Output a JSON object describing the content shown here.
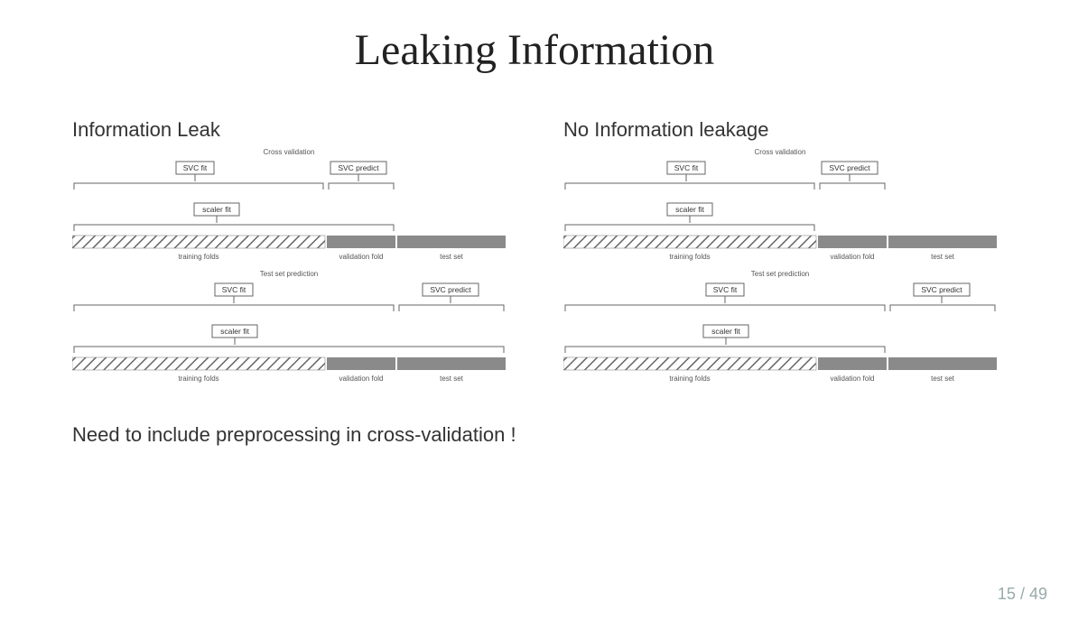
{
  "title": "Leaking Information",
  "left_heading": "Information Leak",
  "right_heading": "No Information leakage",
  "conclusion": "Need to include preprocessing in cross-validation !",
  "page_current": "15",
  "page_total": "49",
  "labels": {
    "cross_validation": "Cross validation",
    "test_set_prediction": "Test set prediction",
    "svc_fit": "SVC fit",
    "svc_predict": "SVC predict",
    "scaler_fit": "scaler fit",
    "training_folds": "training folds",
    "validation_fold": "validation fold",
    "test_set": "test set"
  },
  "chart_data": {
    "type": "diagram",
    "note": "Two side-by-side schematic pipelines comparing information leak vs no leakage. Each side has two subpanels (Cross validation, Test set prediction). Data bar is composed of: training folds (hatched), validation fold (grey), test set (grey). In the 'Information Leak' panels, scaler_fit spans training+validation (top) or all three segments (bottom). In the 'No Information leakage' panels, scaler_fit spans only training folds. SVC fit is applied over training folds; SVC predict is applied to validation fold (top) or test set (bottom).",
    "segments": {
      "training_folds": 0.58,
      "validation_fold": 0.16,
      "test_set": 0.26
    },
    "panels": [
      {
        "side": "left",
        "sub": "cross_validation",
        "scaler_fit_span": [
          "training_folds",
          "validation_fold"
        ],
        "svc_fit_span": [
          "training_folds"
        ],
        "svc_predict_target": "validation_fold"
      },
      {
        "side": "left",
        "sub": "test_set_prediction",
        "scaler_fit_span": [
          "training_folds",
          "validation_fold",
          "test_set"
        ],
        "svc_fit_span": [
          "training_folds",
          "validation_fold"
        ],
        "svc_predict_target": "test_set"
      },
      {
        "side": "right",
        "sub": "cross_validation",
        "scaler_fit_span": [
          "training_folds"
        ],
        "svc_fit_span": [
          "training_folds"
        ],
        "svc_predict_target": "validation_fold"
      },
      {
        "side": "right",
        "sub": "test_set_prediction",
        "scaler_fit_span": [
          "training_folds",
          "validation_fold"
        ],
        "svc_fit_span": [
          "training_folds",
          "validation_fold"
        ],
        "svc_predict_target": "test_set"
      }
    ]
  }
}
